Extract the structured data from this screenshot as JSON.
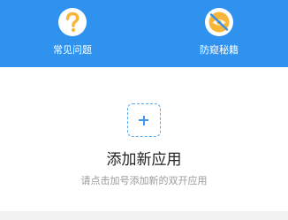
{
  "colors": {
    "header_blue": "#2f92ef",
    "icon_yellow": "#f7b63a",
    "accent_blue": "#3f97ea",
    "title_text": "#222222",
    "hint_text": "#9a9a9a"
  },
  "shortcuts": [
    {
      "label": "常见问题",
      "icon": "question-icon"
    },
    {
      "label": "防窥秘籍",
      "icon": "anti-peep-icon"
    }
  ],
  "add_app": {
    "icon": "plus-icon",
    "title": "添加新应用",
    "hint": "请点击加号添加新的双开应用"
  }
}
